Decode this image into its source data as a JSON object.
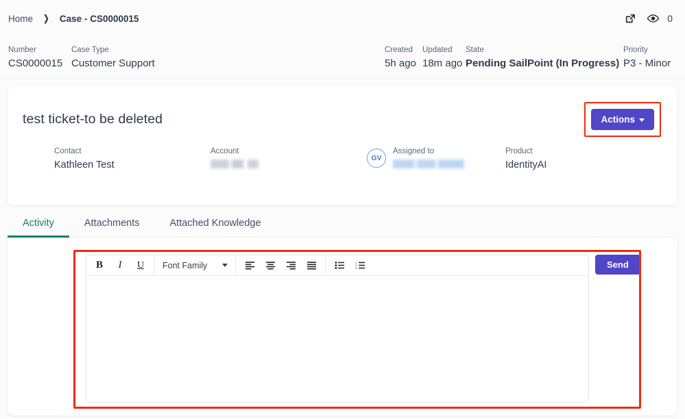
{
  "breadcrumb": {
    "home_label": "Home",
    "separator": "❯",
    "current_label": "Case - CS0000015"
  },
  "topbar": {
    "open_external_icon": "external-link-icon",
    "watch_icon": "eye-icon",
    "watch_count": "0"
  },
  "meta": {
    "number": {
      "label": "Number",
      "value": "CS0000015"
    },
    "case_type": {
      "label": "Case Type",
      "value": "Customer Support"
    },
    "created": {
      "label": "Created",
      "value": "5h ago"
    },
    "updated": {
      "label": "Updated",
      "value": "18m ago"
    },
    "state": {
      "label": "State",
      "value": "Pending SailPoint (In Progress)"
    },
    "priority": {
      "label": "Priority",
      "value": "P3 - Minor"
    }
  },
  "detail": {
    "title": "test ticket-to be deleted",
    "actions_label": "Actions",
    "actions_caret_icon": "caret-down-icon",
    "fields": {
      "contact": {
        "label": "Contact",
        "value": "Kathleen Test"
      },
      "account": {
        "label": "Account",
        "value": ""
      },
      "assigned_to": {
        "label": "Assigned to",
        "value": "",
        "avatar_initials": "GV"
      },
      "product": {
        "label": "Product",
        "value": "IdentityAI"
      }
    }
  },
  "tabs": [
    {
      "label": "Activity",
      "active": true
    },
    {
      "label": "Attachments",
      "active": false
    },
    {
      "label": "Attached Knowledge",
      "active": false
    }
  ],
  "editor": {
    "toolbar": {
      "bold_label": "B",
      "italic_label": "I",
      "underline_label": "U",
      "font_family_label": "Font Family",
      "align_left_icon": "align-left-icon",
      "align_center_icon": "align-center-icon",
      "align_right_icon": "align-right-icon",
      "align_justify_icon": "align-justify-icon",
      "bullet_list_icon": "bullet-list-icon",
      "numbered_list_icon": "numbered-list-icon"
    },
    "body_value": "",
    "body_placeholder": "",
    "send_label": "Send"
  },
  "colors": {
    "accent_purple": "#4f46c8",
    "tab_active_green": "#148162",
    "annotation_red": "#f5290a",
    "page_background": "#fbfbfc",
    "text_primary": "#2e3a4e",
    "text_secondary": "#5b6679"
  }
}
